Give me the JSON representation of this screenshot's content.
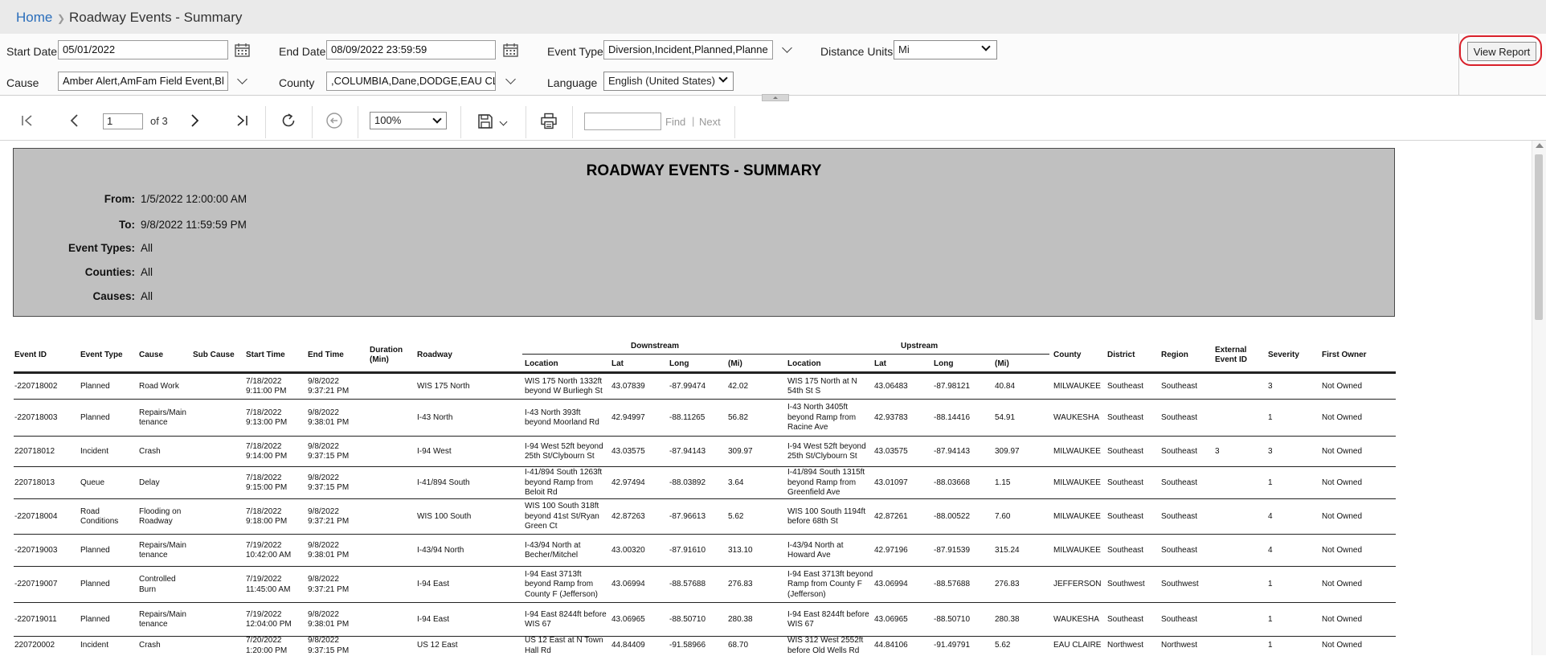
{
  "breadcrumb": {
    "home": "Home",
    "page": "Roadway Events - Summary"
  },
  "params": {
    "start_date_label": "Start Date",
    "start_date_value": "05/01/2022",
    "end_date_label": "End Date",
    "end_date_value": "08/09/2022 23:59:59",
    "event_type_label": "Event Type",
    "event_type_value": "Diversion,Incident,Planned,Planne",
    "distance_units_label": "Distance Units",
    "distance_units_value": "Mi",
    "cause_label": "Cause",
    "cause_value": "Amber Alert,AmFam Field Event,Bl",
    "county_label": "County",
    "county_value": ",COLUMBIA,Dane,DODGE,EAU CLA",
    "language_label": "Language",
    "language_value": "English (United States)",
    "view_report": "View Report"
  },
  "toolbar": {
    "page_number": "1",
    "page_of": "of 3",
    "zoom": "100%",
    "find_label": "Find",
    "find_sep": "|",
    "next_label": "Next"
  },
  "report": {
    "title": "ROADWAY EVENTS - SUMMARY",
    "from_label": "From:",
    "from_value": "1/5/2022 12:00:00 AM",
    "to_label": "To:",
    "to_value": "9/8/2022 11:59:59 PM",
    "event_types_label": "Event Types:",
    "event_types_value": "All",
    "counties_label": "Counties:",
    "counties_value": "All",
    "causes_label": "Causes:",
    "causes_value": "All"
  },
  "table": {
    "group_downstream": "Downstream",
    "group_upstream": "Upstream",
    "columns": {
      "event_id": "Event ID",
      "event_type": "Event Type",
      "cause": "Cause",
      "sub_cause": "Sub Cause",
      "start_time": "Start Time",
      "end_time": "End Time",
      "duration": "Duration\n(Min)",
      "roadway": "Roadway",
      "ds_location": "Location",
      "ds_lat": "Lat",
      "ds_long": "Long",
      "ds_mi": "(Mi)",
      "us_location": "Location",
      "us_lat": "Lat",
      "us_long": "Long",
      "us_mi": "(Mi)",
      "county": "County",
      "district": "District",
      "region": "Region",
      "external_id": "External\nEvent ID",
      "severity": "Severity",
      "first_owner": "First Owner"
    },
    "rows": [
      {
        "event_id": "-220718002",
        "event_type": "Planned",
        "cause": "Road Work",
        "sub_cause": "",
        "start_time": "7/18/2022\n9:11:00 PM",
        "end_time": "9/8/2022\n9:37:21 PM",
        "duration": "",
        "roadway": "WIS 175 North",
        "ds_location": "WIS 175 North 1332ft\nbeyond W Burliegh St",
        "ds_lat": "43.07839",
        "ds_long": "-87.99474",
        "ds_mi": "42.02",
        "us_location": "WIS 175 North at N\n54th St S",
        "us_lat": "43.06483",
        "us_long": "-87.98121",
        "us_mi": "40.84",
        "county": "MILWAUKEE",
        "district": "Southeast",
        "region": "Southeast",
        "external_id": "",
        "severity": "3",
        "first_owner": "Not Owned"
      },
      {
        "event_id": "-220718003",
        "event_type": "Planned",
        "cause": "Repairs/Main\ntenance",
        "sub_cause": "",
        "start_time": "7/18/2022\n9:13:00 PM",
        "end_time": "9/8/2022\n9:38:01 PM",
        "duration": "",
        "roadway": "I-43 North",
        "ds_location": "I-43 North 393ft\nbeyond Moorland Rd",
        "ds_lat": "42.94997",
        "ds_long": "-88.11265",
        "ds_mi": "56.82",
        "us_location": "I-43 North 3405ft\nbeyond Ramp from\nRacine Ave",
        "us_lat": "42.93783",
        "us_long": "-88.14416",
        "us_mi": "54.91",
        "county": "WAUKESHA",
        "district": "Southeast",
        "region": "Southeast",
        "external_id": "",
        "severity": "1",
        "first_owner": "Not Owned"
      },
      {
        "event_id": "220718012",
        "event_type": "Incident",
        "cause": "Crash",
        "sub_cause": "",
        "start_time": "7/18/2022\n9:14:00 PM",
        "end_time": "9/8/2022\n9:37:15 PM",
        "duration": "",
        "roadway": "I-94 West",
        "ds_location": "I-94 West 52ft beyond\n25th St/Clybourn St",
        "ds_lat": "43.03575",
        "ds_long": "-87.94143",
        "ds_mi": "309.97",
        "us_location": "I-94 West 52ft beyond\n25th St/Clybourn St",
        "us_lat": "43.03575",
        "us_long": "-87.94143",
        "us_mi": "309.97",
        "county": "MILWAUKEE",
        "district": "Southeast",
        "region": "Southeast",
        "external_id": "3",
        "severity": "3",
        "first_owner": "Not Owned"
      },
      {
        "event_id": "220718013",
        "event_type": "Queue",
        "cause": "Delay",
        "sub_cause": "",
        "start_time": "7/18/2022\n9:15:00 PM",
        "end_time": "9/8/2022\n9:37:15 PM",
        "duration": "",
        "roadway": "I-41/894 South",
        "ds_location": "I-41/894 South 1263ft\nbeyond Ramp from\nBeloit Rd",
        "ds_lat": "42.97494",
        "ds_long": "-88.03892",
        "ds_mi": "3.64",
        "us_location": "I-41/894 South 1315ft\nbeyond Ramp from\nGreenfield Ave",
        "us_lat": "43.01097",
        "us_long": "-88.03668",
        "us_mi": "1.15",
        "county": "MILWAUKEE",
        "district": "Southeast",
        "region": "Southeast",
        "external_id": "",
        "severity": "1",
        "first_owner": "Not Owned"
      },
      {
        "event_id": "-220718004",
        "event_type": "Road\nConditions",
        "cause": "Flooding on\nRoadway",
        "sub_cause": "",
        "start_time": "7/18/2022\n9:18:00 PM",
        "end_time": "9/8/2022\n9:37:21 PM",
        "duration": "",
        "roadway": "WIS 100 South",
        "ds_location": "WIS 100 South 318ft\nbeyond 41st St/Ryan\nGreen Ct",
        "ds_lat": "42.87263",
        "ds_long": "-87.96613",
        "ds_mi": "5.62",
        "us_location": "WIS 100 South 1194ft\nbefore 68th St",
        "us_lat": "42.87261",
        "us_long": "-88.00522",
        "us_mi": "7.60",
        "county": "MILWAUKEE",
        "district": "Southeast",
        "region": "Southeast",
        "external_id": "",
        "severity": "4",
        "first_owner": "Not Owned"
      },
      {
        "event_id": "-220719003",
        "event_type": "Planned",
        "cause": "Repairs/Main\ntenance",
        "sub_cause": "",
        "start_time": "7/19/2022\n10:42:00 AM",
        "end_time": "9/8/2022\n9:38:01 PM",
        "duration": "",
        "roadway": "I-43/94 North",
        "ds_location": "I-43/94 North at\nBecher/Mitchel",
        "ds_lat": "43.00320",
        "ds_long": "-87.91610",
        "ds_mi": "313.10",
        "us_location": "I-43/94 North at\nHoward Ave",
        "us_lat": "42.97196",
        "us_long": "-87.91539",
        "us_mi": "315.24",
        "county": "MILWAUKEE",
        "district": "Southeast",
        "region": "Southeast",
        "external_id": "",
        "severity": "4",
        "first_owner": "Not Owned"
      },
      {
        "event_id": "-220719007",
        "event_type": "Planned",
        "cause": "Controlled\nBurn",
        "sub_cause": "",
        "start_time": "7/19/2022\n11:45:00 AM",
        "end_time": "9/8/2022\n9:37:21 PM",
        "duration": "",
        "roadway": "I-94 East",
        "ds_location": "I-94 East 3713ft\nbeyond Ramp from\nCounty F (Jefferson)",
        "ds_lat": "43.06994",
        "ds_long": "-88.57688",
        "ds_mi": "276.83",
        "us_location": "I-94 East 3713ft beyond\nRamp from County F\n(Jefferson)",
        "us_lat": "43.06994",
        "us_long": "-88.57688",
        "us_mi": "276.83",
        "county": "JEFFERSON",
        "district": "Southwest",
        "region": "Southwest",
        "external_id": "",
        "severity": "1",
        "first_owner": "Not Owned"
      },
      {
        "event_id": "-220719011",
        "event_type": "Planned",
        "cause": "Repairs/Main\ntenance",
        "sub_cause": "",
        "start_time": "7/19/2022\n12:04:00 PM",
        "end_time": "9/8/2022\n9:38:01 PM",
        "duration": "",
        "roadway": "I-94 East",
        "ds_location": "I-94 East 8244ft before\nWIS 67",
        "ds_lat": "43.06965",
        "ds_long": "-88.50710",
        "ds_mi": "280.38",
        "us_location": "I-94 East 8244ft before\nWIS 67",
        "us_lat": "43.06965",
        "us_long": "-88.50710",
        "us_mi": "280.38",
        "county": "WAUKESHA",
        "district": "Southeast",
        "region": "Southeast",
        "external_id": "",
        "severity": "1",
        "first_owner": "Not Owned"
      },
      {
        "event_id": "220720002",
        "event_type": "Incident",
        "cause": "Crash",
        "sub_cause": "",
        "start_time": "7/20/2022\n1:20:00 PM",
        "end_time": "9/8/2022\n9:37:15 PM",
        "duration": "",
        "roadway": "US 12 East",
        "ds_location": "US 12 East at N Town\nHall Rd",
        "ds_lat": "44.84409",
        "ds_long": "-91.58966",
        "ds_mi": "68.70",
        "us_location": "WIS 312 West 2552ft\nbefore Old Wells Rd",
        "us_lat": "44.84106",
        "us_long": "-91.49791",
        "us_mi": "5.62",
        "county": "EAU CLAIRE",
        "district": "Northwest",
        "region": "Northwest",
        "external_id": "",
        "severity": "1",
        "first_owner": "Not Owned"
      }
    ]
  }
}
